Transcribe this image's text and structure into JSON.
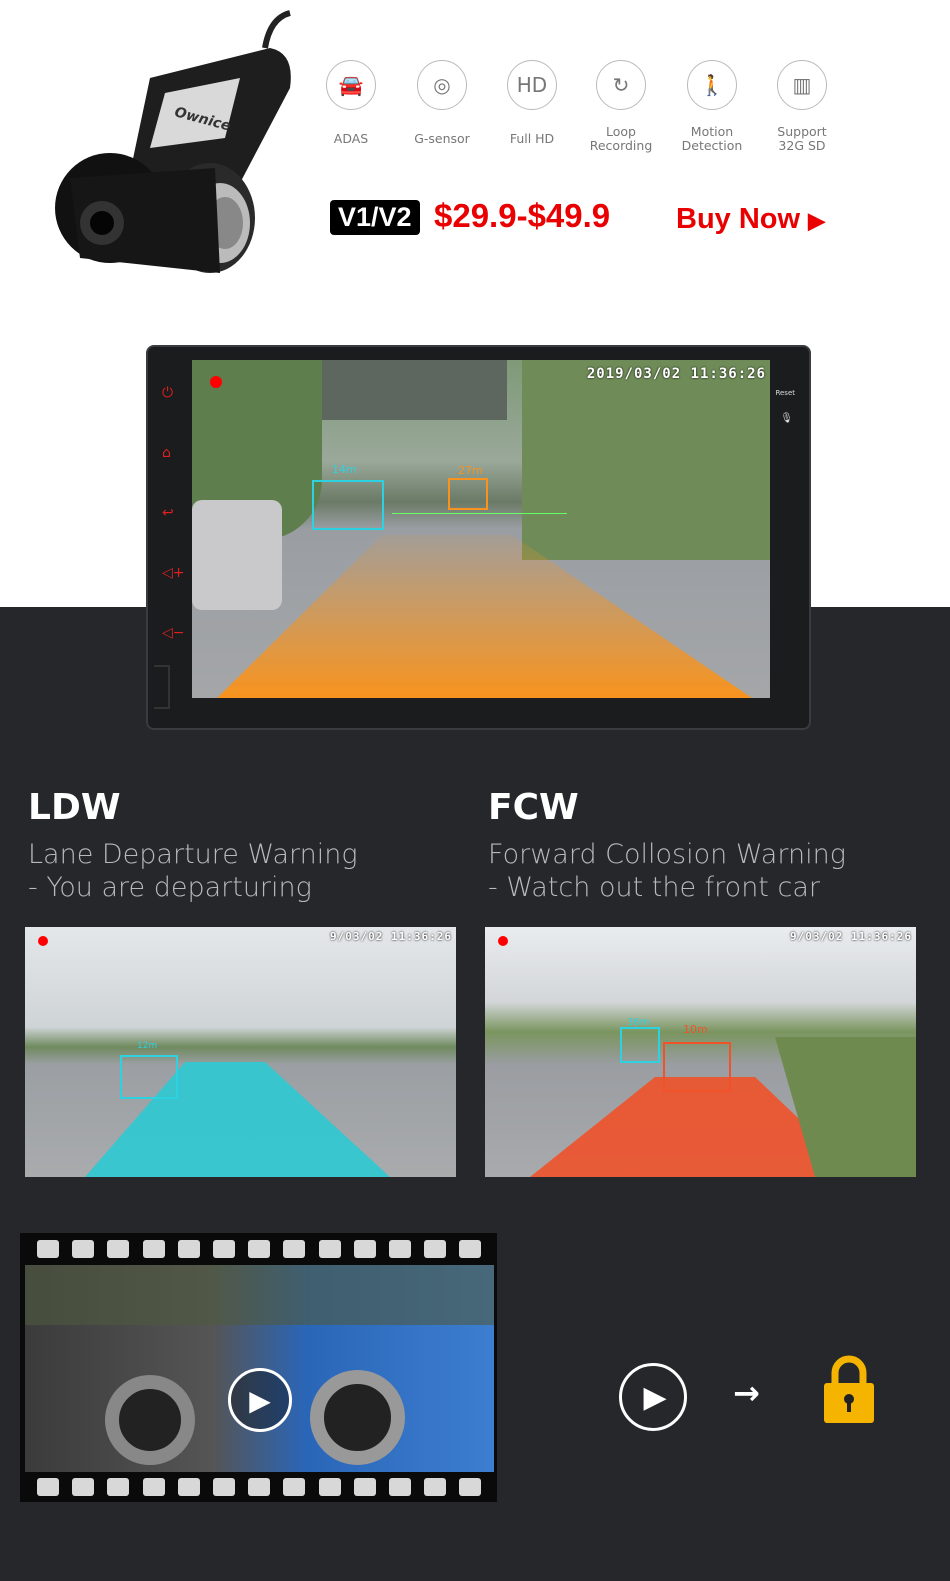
{
  "product": {
    "brand_logo": "Ownice"
  },
  "features": [
    {
      "icon": "car-adas-icon",
      "label": "ADAS"
    },
    {
      "icon": "g-sensor-icon",
      "label": "G-sensor"
    },
    {
      "icon": "full-hd-icon",
      "label": "Full HD"
    },
    {
      "icon": "loop-recording-icon",
      "label": "Loop\nRecording"
    },
    {
      "icon": "motion-detection-icon",
      "label": "Motion\nDetection"
    },
    {
      "icon": "sd-card-icon",
      "label": "Support\n32G SD"
    }
  ],
  "pricing": {
    "version_badge": "V1/V2",
    "price": "$29.9-$49.9",
    "buy_label": "Buy Now"
  },
  "head_unit": {
    "timestamp": "2019/03/02  11:36:26",
    "reset_label": "Reset",
    "distance_near": "14m",
    "distance_far": "27m"
  },
  "ldw": {
    "title": "LDW",
    "subtitle_1": "Lane Departure Warning",
    "subtitle_2": "- You are departuring",
    "timestamp": "9/03/02 11:36:26",
    "distance": "12m",
    "lane_color": "#2ec9d1"
  },
  "fcw": {
    "title": "FCW",
    "subtitle_1": "Forward Collosion Warning",
    "subtitle_2": "- Watch out the front car",
    "timestamp": "9/03/02 11:36:26",
    "distance_truck": "36m",
    "distance_front": "10m",
    "lane_color": "#f0522a"
  },
  "colors": {
    "accent_red": "#e90000",
    "dark_bg": "#25272b",
    "lock": "#f5b400",
    "orange_lane": "#f7931e"
  }
}
